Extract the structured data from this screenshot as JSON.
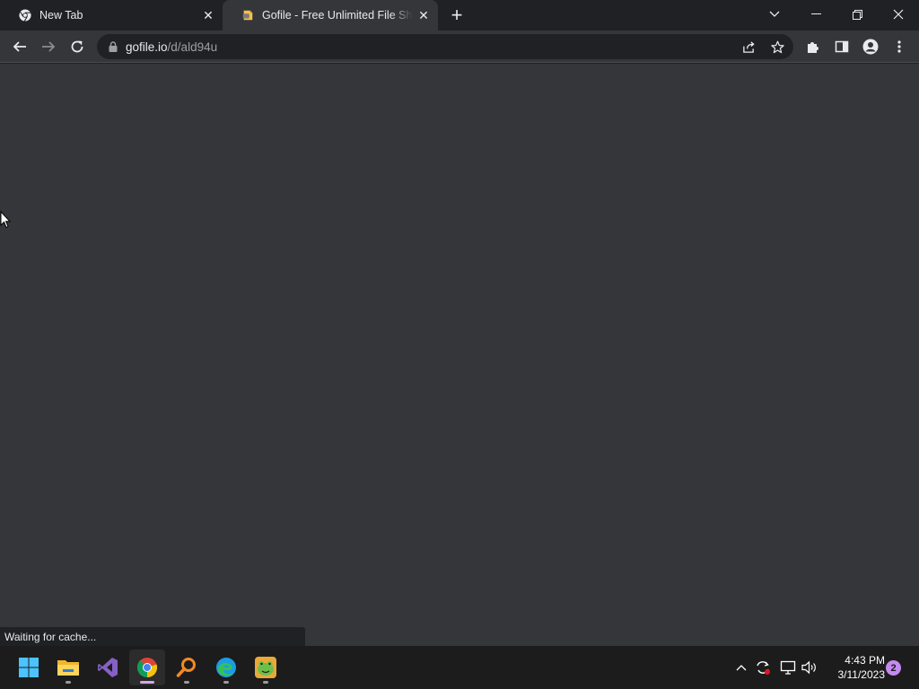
{
  "browser": {
    "tabs": [
      {
        "title": "New Tab",
        "icon": "chrome-icon",
        "active": false
      },
      {
        "title": "Gofile - Free Unlimited File Sharing",
        "icon": "gofile-favicon",
        "active": true
      }
    ],
    "address_bar": {
      "host": "gofile.io",
      "path": "/d/ald94u"
    },
    "status_text": "Waiting for cache..."
  },
  "taskbar": {
    "apps": [
      {
        "name": "Start",
        "icon": "windows-start-icon"
      },
      {
        "name": "File Explorer",
        "icon": "file-explorer-icon"
      },
      {
        "name": "Visual Studio",
        "icon": "visual-studio-icon"
      },
      {
        "name": "Google Chrome",
        "icon": "chrome-icon"
      },
      {
        "name": "Search Tool",
        "icon": "magnifier-icon"
      },
      {
        "name": "Microsoft Edge",
        "icon": "edge-icon"
      },
      {
        "name": "Game App",
        "icon": "frog-game-icon"
      }
    ],
    "clock": {
      "time": "4:43 PM",
      "date": "3/11/2023"
    },
    "notification_count": "2"
  },
  "colors": {
    "frame": "#202124",
    "toolbar": "#35363a",
    "content": "#35363a",
    "taskbar": "#1c1c1c",
    "accent": "#c58af0"
  }
}
